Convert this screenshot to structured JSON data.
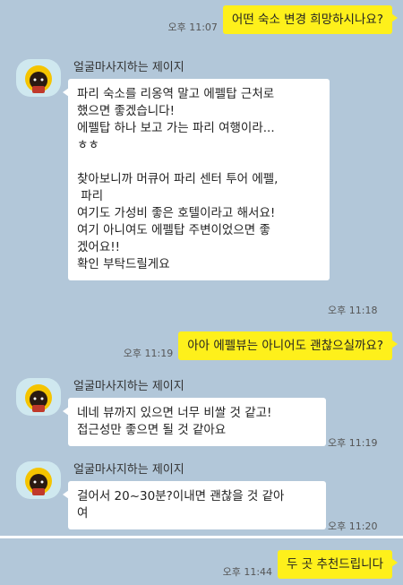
{
  "messages": [
    {
      "type": "out",
      "time": "오후 11:07",
      "text": "어떤 숙소 변경 희망하시나요?"
    },
    {
      "type": "in",
      "sender": "얼굴마사지하는 제이지",
      "time": "오후 11:18",
      "text": "파리 숙소를 리옹역 말고 에펠탑 근처로\n했으면 좋겠습니다!\n에펠탑 하나 보고 가는 파리 여행이라...\nㅎㅎ\n\n찾아보니까 머큐어 파리 센터 투어 에펠,\n 파리\n여기도 가성비 좋은 호텔이라고 해서요!\n여기 아니여도 에펠탑 주변이었으면 좋\n겠어요!!\n확인 부탁드릴게요"
    },
    {
      "type": "out",
      "time": "오후 11:19",
      "text": "아아 에펠뷰는 아니어도 괜찮으실까요?"
    },
    {
      "type": "in",
      "sender": "얼굴마사지하는 제이지",
      "time": "오후 11:19",
      "text": "네네 뷰까지 있으면 너무 비쌀 것 같고!\n접근성만 좋으면 될 것 같아요"
    },
    {
      "type": "in",
      "sender": "얼굴마사지하는 제이지",
      "time": "오후 11:20",
      "text": "걸어서 20~30분?이내면 괜찮을 것 같아\n여"
    },
    {
      "type": "out",
      "time": "오후 11:44",
      "text": "두 곳 추천드립니다"
    }
  ]
}
